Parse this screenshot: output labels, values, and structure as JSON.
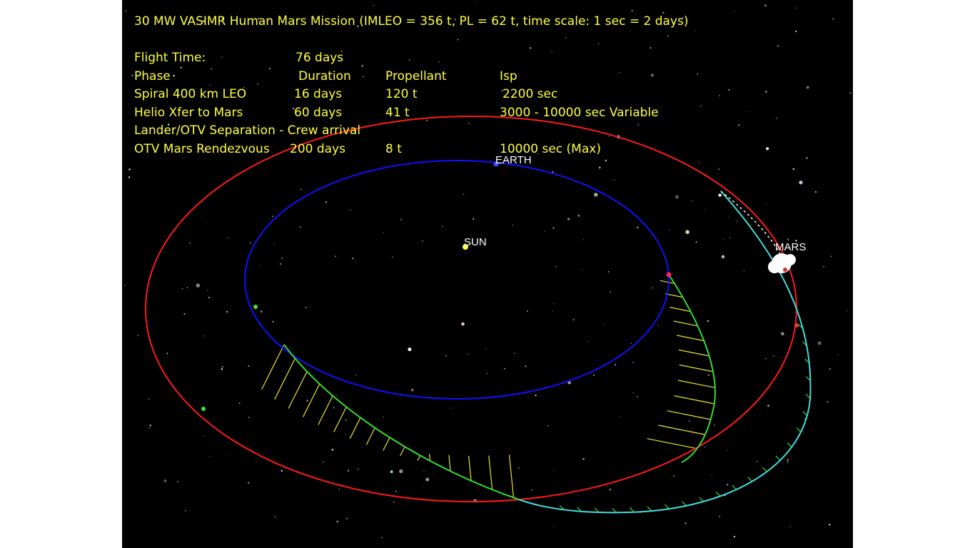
{
  "title": "30 MW VASIMR Human Mars Mission (IMLEO = 356 t, PL = 62 t, time scale: 1 sec = 2 days)",
  "flight_time": {
    "label": "Flight Time:",
    "value": "76 days"
  },
  "table": {
    "headers": [
      "Phase",
      "Duration",
      "Propellant",
      "Isp"
    ],
    "rows": [
      [
        "Spiral 400 km LEO",
        "16 days",
        "120 t",
        "2200 sec"
      ],
      [
        "Helio Xfer to Mars",
        "60 days",
        "41 t",
        "3000 - 10000 sec Variable"
      ],
      [
        "Lander/OTV Separation - Crew arrival",
        "",
        "",
        ""
      ],
      [
        "OTV Mars Rendezvous",
        "200 days",
        "8 t",
        "10000 sec (Max)"
      ]
    ]
  },
  "bodies": {
    "sun": "SUN",
    "earth": "EARTH",
    "mars": "MARS"
  },
  "colors": {
    "background": "#000000",
    "text": "#ffff40",
    "earth_orbit": "#1010ff",
    "mars_orbit": "#ff1a1a",
    "transfer_trajectory": "#33dd33",
    "return_trajectory": "#44dddd",
    "thrust_vectors": "#e6e633"
  }
}
